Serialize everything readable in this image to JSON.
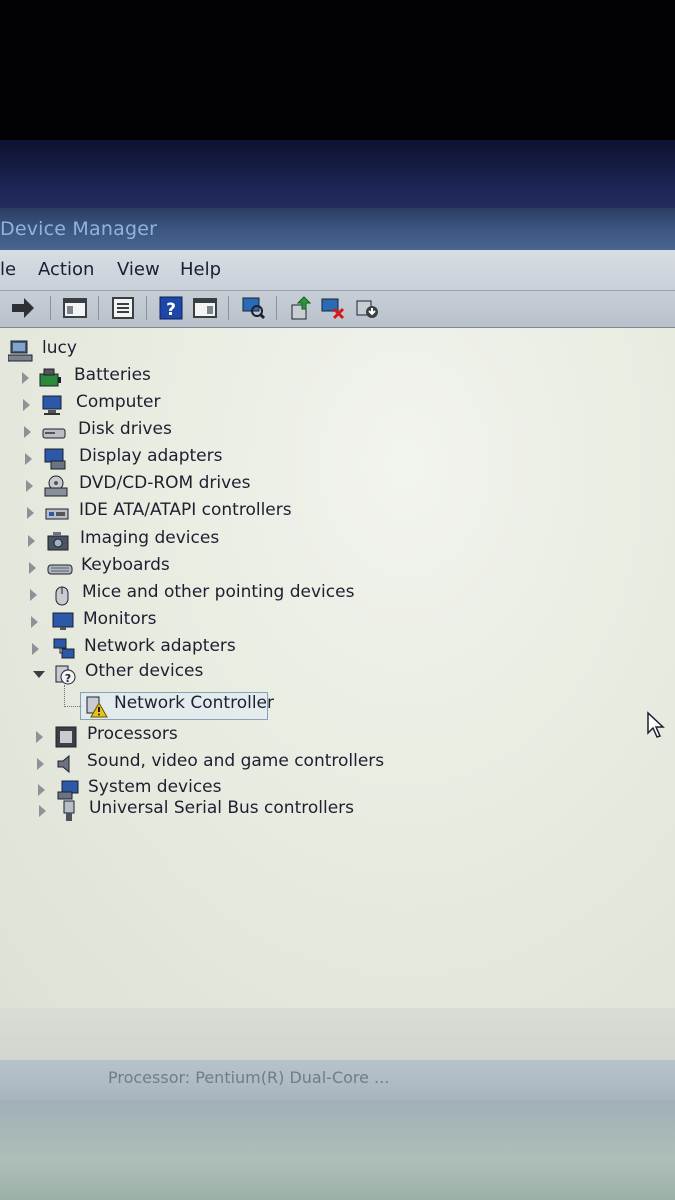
{
  "window": {
    "title": "Device Manager"
  },
  "menu": {
    "items": [
      "le",
      "Action",
      "View",
      "Help"
    ]
  },
  "toolbar": {
    "buttons": [
      "forward-icon",
      "console-tree-icon",
      "properties-icon",
      "help-icon",
      "action-pane-icon",
      "scan-hardware-icon",
      "update-driver-icon",
      "uninstall-icon",
      "disable-icon"
    ]
  },
  "tree": {
    "root": "lucy",
    "items": [
      {
        "label": "Batteries",
        "icon": "battery-icon",
        "expanded": false
      },
      {
        "label": "Computer",
        "icon": "computer-icon",
        "expanded": false
      },
      {
        "label": "Disk drives",
        "icon": "disk-drive-icon",
        "expanded": false
      },
      {
        "label": "Display adapters",
        "icon": "display-adapter-icon",
        "expanded": false
      },
      {
        "label": "DVD/CD-ROM drives",
        "icon": "dvd-drive-icon",
        "expanded": false
      },
      {
        "label": "IDE ATA/ATAPI controllers",
        "icon": "ide-controller-icon",
        "expanded": false
      },
      {
        "label": "Imaging devices",
        "icon": "camera-icon",
        "expanded": false
      },
      {
        "label": "Keyboards",
        "icon": "keyboard-icon",
        "expanded": false
      },
      {
        "label": "Mice and other pointing devices",
        "icon": "mouse-icon",
        "expanded": false
      },
      {
        "label": "Monitors",
        "icon": "monitor-icon",
        "expanded": false
      },
      {
        "label": "Network adapters",
        "icon": "network-adapter-icon",
        "expanded": false
      },
      {
        "label": "Other devices",
        "icon": "unknown-device-icon",
        "expanded": true
      },
      {
        "label": "Network Controller",
        "icon": "warning-device-icon",
        "child": true,
        "selected": true
      },
      {
        "label": "Processors",
        "icon": "processor-icon",
        "expanded": false
      },
      {
        "label": "Sound, video and game controllers",
        "icon": "speaker-icon",
        "expanded": false
      },
      {
        "label": "System devices",
        "icon": "system-device-icon",
        "expanded": false
      },
      {
        "label": "Universal Serial Bus controllers",
        "icon": "usb-icon",
        "expanded": false
      }
    ]
  },
  "status": {
    "text": "Processor: Pentium(R) Dual-Core ..."
  },
  "colors": {
    "title_bar": "#3c5582",
    "title_text": "#8fb4da",
    "tree_bg": "#e9ede2",
    "warning": "#e8c21a"
  }
}
